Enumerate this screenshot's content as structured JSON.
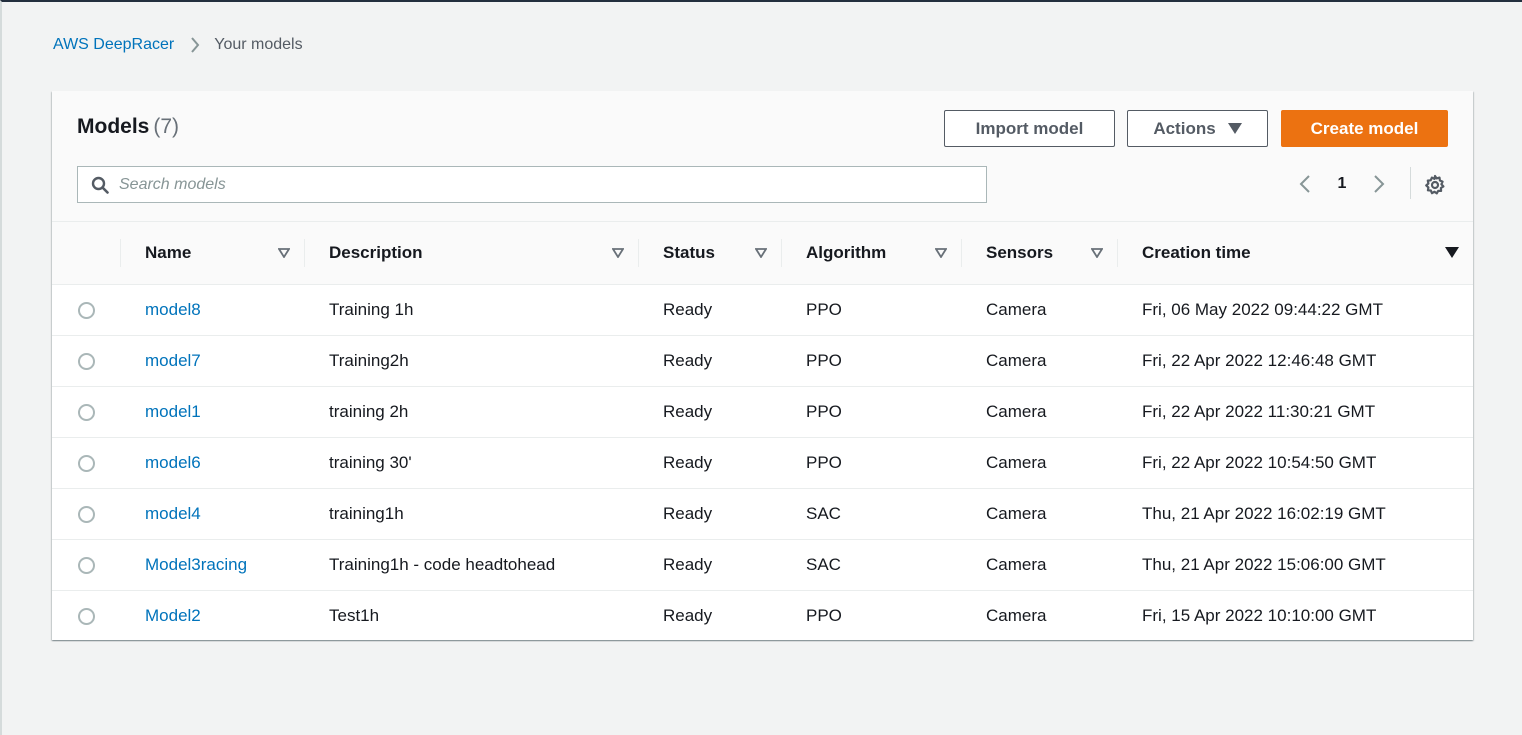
{
  "breadcrumb": {
    "root": "AWS DeepRacer",
    "current": "Your models"
  },
  "panel": {
    "title": "Models",
    "count": "(7)",
    "buttons": {
      "import": "Import model",
      "actions": "Actions",
      "create": "Create model"
    },
    "search": {
      "placeholder": "Search models",
      "value": ""
    },
    "pagination": {
      "current_page": "1"
    }
  },
  "table": {
    "columns": [
      "Name",
      "Description",
      "Status",
      "Algorithm",
      "Sensors",
      "Creation time"
    ],
    "sorted_column": "Creation time",
    "rows": [
      {
        "name": "model8",
        "description": "Training 1h",
        "status": "Ready",
        "algorithm": "PPO",
        "sensors": "Camera",
        "created": "Fri, 06 May 2022 09:44:22 GMT"
      },
      {
        "name": "model7",
        "description": "Training2h",
        "status": "Ready",
        "algorithm": "PPO",
        "sensors": "Camera",
        "created": "Fri, 22 Apr 2022 12:46:48 GMT"
      },
      {
        "name": "model1",
        "description": "training 2h",
        "status": "Ready",
        "algorithm": "PPO",
        "sensors": "Camera",
        "created": "Fri, 22 Apr 2022 11:30:21 GMT"
      },
      {
        "name": "model6",
        "description": "training 30'",
        "status": "Ready",
        "algorithm": "PPO",
        "sensors": "Camera",
        "created": "Fri, 22 Apr 2022 10:54:50 GMT"
      },
      {
        "name": "model4",
        "description": "training1h",
        "status": "Ready",
        "algorithm": "SAC",
        "sensors": "Camera",
        "created": "Thu, 21 Apr 2022 16:02:19 GMT"
      },
      {
        "name": "Model3racing",
        "description": "Training1h - code headtohead",
        "status": "Ready",
        "algorithm": "SAC",
        "sensors": "Camera",
        "created": "Thu, 21 Apr 2022 15:06:00 GMT"
      },
      {
        "name": "Model2",
        "description": "Test1h",
        "status": "Ready",
        "algorithm": "PPO",
        "sensors": "Camera",
        "created": "Fri, 15 Apr 2022 10:10:00 GMT"
      }
    ]
  },
  "colors": {
    "link": "#0073bb",
    "primary_button": "#ec7211",
    "background": "#f2f3f3"
  }
}
